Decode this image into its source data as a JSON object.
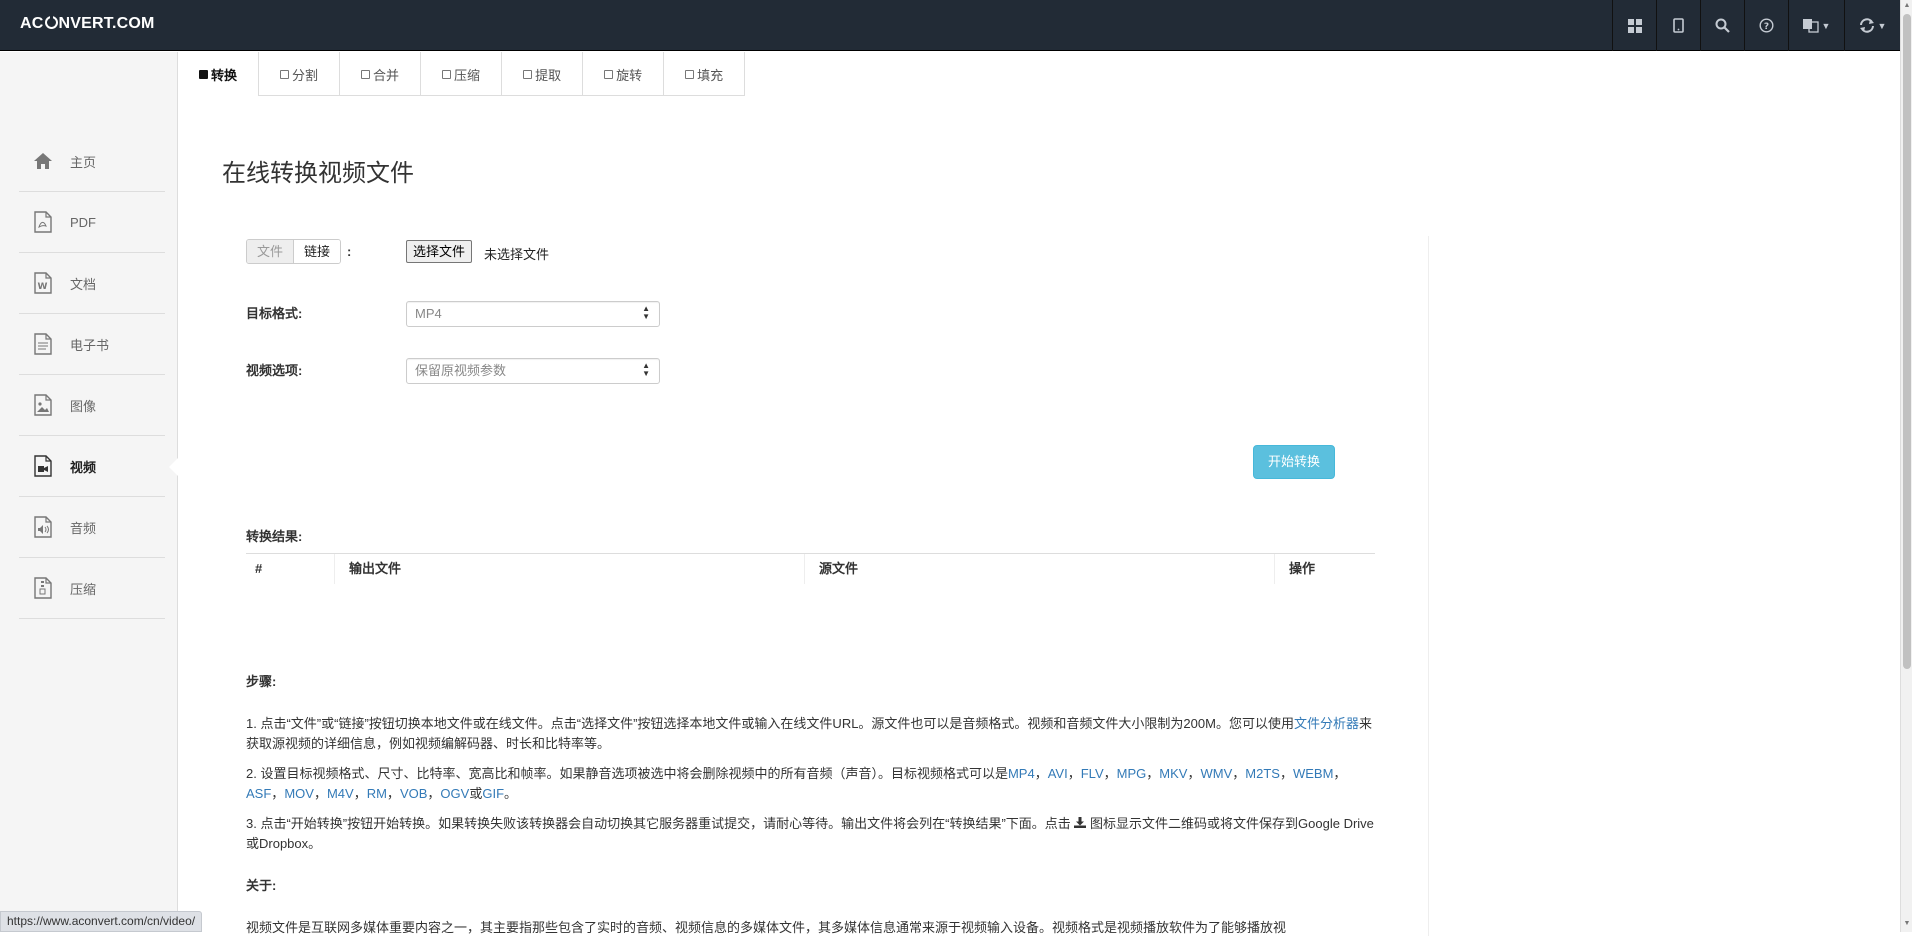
{
  "brand": {
    "left": "AC",
    "right": "NVERT.COM"
  },
  "navbar": {
    "icons": [
      "grid-icon",
      "tablet-icon",
      "search-icon",
      "question-icon",
      "language-icon",
      "refresh-icon"
    ]
  },
  "sidebar": {
    "items": [
      {
        "label": "主页",
        "icon": "home-icon"
      },
      {
        "label": "PDF",
        "icon": "pdf-file-icon"
      },
      {
        "label": "文档",
        "icon": "word-file-icon"
      },
      {
        "label": "电子书",
        "icon": "text-file-icon"
      },
      {
        "label": "图像",
        "icon": "image-file-icon"
      },
      {
        "label": "视频",
        "icon": "video-file-icon",
        "active": true
      },
      {
        "label": "音频",
        "icon": "audio-file-icon"
      },
      {
        "label": "压缩",
        "icon": "archive-file-icon"
      }
    ]
  },
  "tabs": [
    {
      "label": "转换",
      "active": true
    },
    {
      "label": "分割"
    },
    {
      "label": "合并"
    },
    {
      "label": "压缩"
    },
    {
      "label": "提取"
    },
    {
      "label": "旋转"
    },
    {
      "label": "填充"
    }
  ],
  "page_title": "在线转换视频文件",
  "form": {
    "source_toggle": {
      "file": "文件",
      "link": "链接",
      "colon": ":"
    },
    "file_button": "选择文件",
    "file_status": "未选择文件",
    "target_format_label": "目标格式:",
    "target_format_value": "MP4",
    "video_options_label": "视频选项:",
    "video_options_value": "保留原视频参数",
    "start_button": "开始转换"
  },
  "results": {
    "label": "转换结果:",
    "columns": [
      "#",
      "输出文件",
      "源文件",
      "操作"
    ]
  },
  "steps": {
    "heading": "步骤:",
    "step1_a": "1. 点击“文件”或“链接”按钮切换本地文件或在线文件。点击“选择文件”按钮选择本地文件或输入在线文件URL。源文件也可以是音频格式。视频和音频文件大小限制为200M。您可以使用",
    "step1_link": "文件分析器",
    "step1_b": "来获取源视频的详细信息，例如视频编解码器、时长和比特率等。",
    "step2_a": "2. 设置目标视频格式、尺寸、比特率、宽高比和帧率。如果静音选项被选中将会删除视频中的所有音频（声音）。目标视频格式可以是",
    "formats": [
      "MP4",
      "AVI",
      "FLV",
      "MPG",
      "MKV",
      "WMV",
      "M2TS",
      "WEBM",
      "ASF",
      "MOV",
      "M4V",
      "RM",
      "VOB",
      "OGV"
    ],
    "sep": "，",
    "or": "或",
    "last_format": "GIF",
    "end": "。",
    "step3_a": "3. 点击“开始转换”按钮开始转换。如果转换失败该转换器会自动切换其它服务器重试提交，请耐心等待。输出文件将会列在“转换结果”下面。点击",
    "step3_b": "图标显示文件二维码或将文件保存到Google Drive或Dropbox。",
    "about_heading": "关于:",
    "about_text": "视频文件是互联网多媒体重要内容之一，其主要指那些包含了实时的音频、视频信息的多媒体文件，其多媒体信息通常来源于视频输入设备。视频格式是视频播放软件为了能够播放视"
  },
  "status_url": "https://www.aconvert.com/cn/video/",
  "colors": {
    "navbar": "#222b36",
    "accent": "#5bc0de",
    "link": "#337ab7"
  }
}
